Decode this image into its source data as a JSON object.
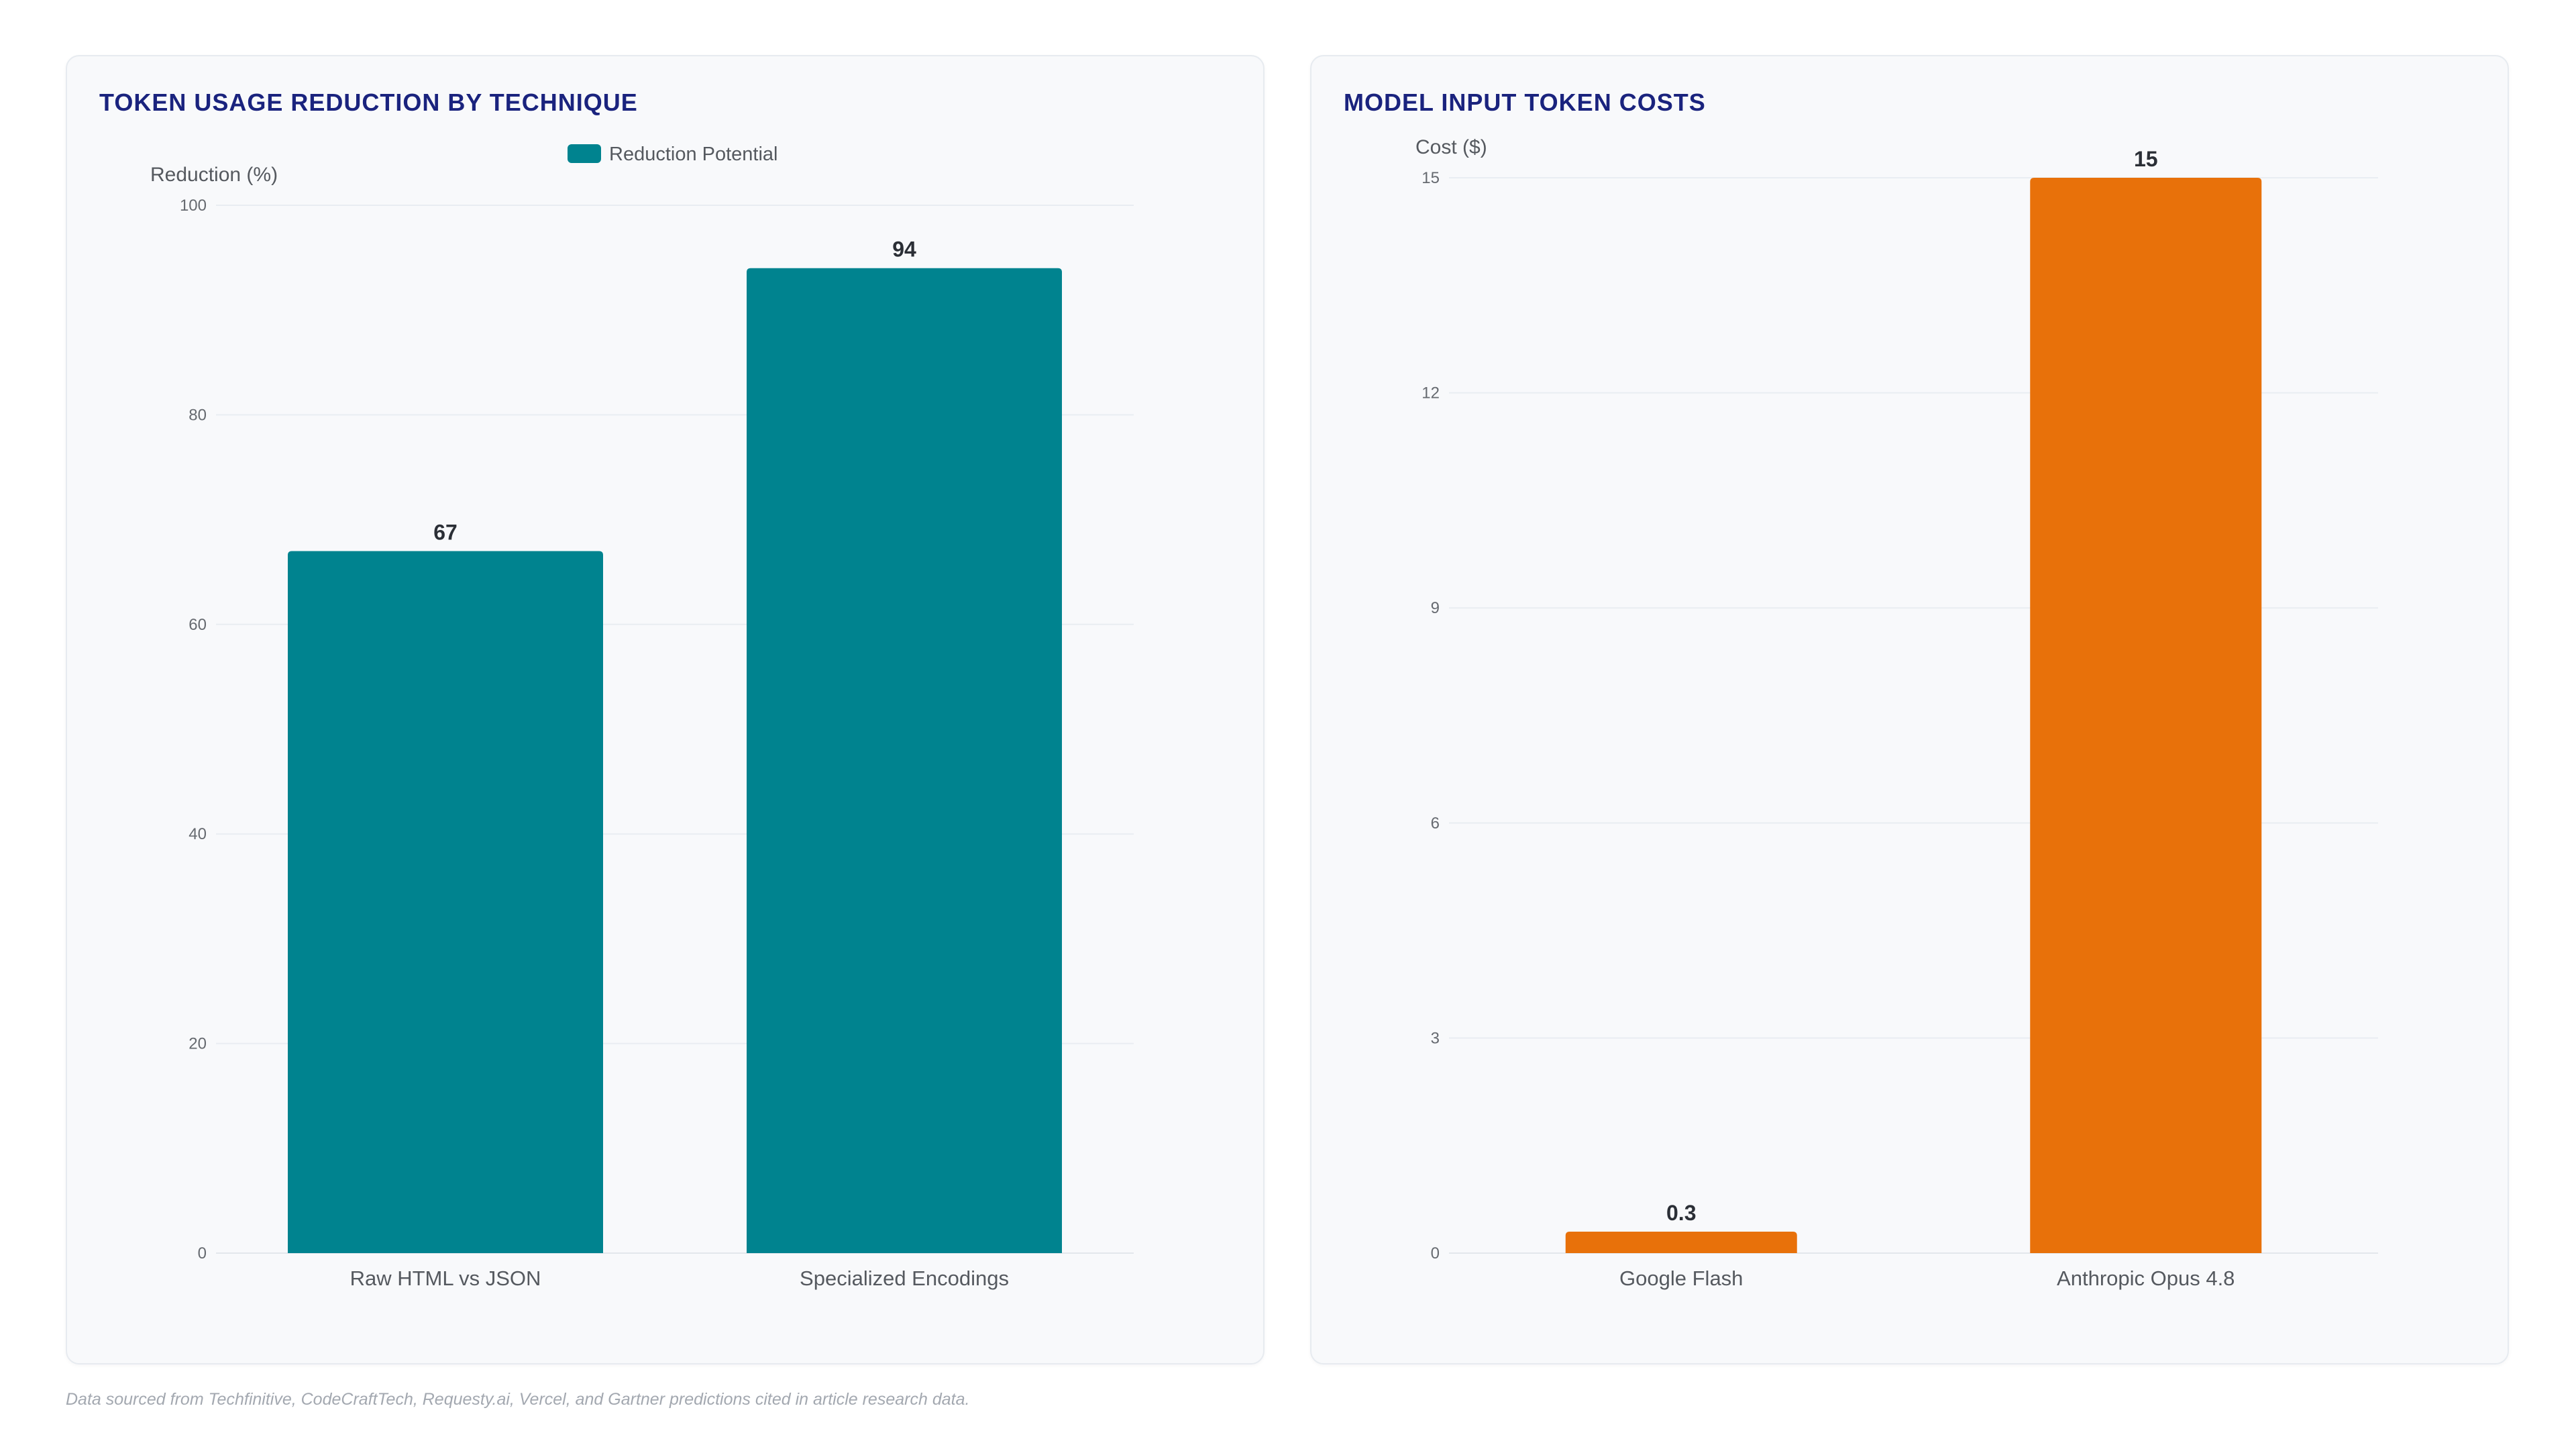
{
  "charts": [
    {
      "title": "TOKEN USAGE REDUCTION BY TECHNIQUE",
      "colors": {
        "bar": "#00838f"
      },
      "chart_data": {
        "type": "bar",
        "categories": [
          "Raw HTML vs JSON",
          "Specialized Encodings"
        ],
        "series": [
          {
            "name": "Reduction Potential",
            "values": [
              67,
              94
            ]
          }
        ],
        "data_labels": [
          "67",
          "94"
        ],
        "ylabel": "Reduction (%)",
        "xlabel": "",
        "ylim": [
          0,
          100
        ],
        "yticks": [
          0,
          20,
          40,
          60,
          80,
          100
        ],
        "grid": true,
        "legend": "top-center"
      }
    },
    {
      "title": "MODEL INPUT TOKEN COSTS",
      "colors": {
        "bar": "#e8710a"
      },
      "chart_data": {
        "type": "bar",
        "categories": [
          "Google Flash",
          "Anthropic Opus 4.8"
        ],
        "series": [
          {
            "values": [
              0.3,
              15
            ]
          }
        ],
        "data_labels": [
          "0.3",
          "15"
        ],
        "ylabel": "Cost ($)",
        "xlabel": "",
        "ylim": [
          0,
          15
        ],
        "yticks": [
          0,
          3,
          6,
          9,
          12,
          15
        ],
        "grid": true,
        "legend": "none"
      }
    }
  ],
  "footnote": "Data sourced from Techfinitive, CodeCraftTech, Requesty.ai, Vercel, and Gartner predictions cited in article research data."
}
